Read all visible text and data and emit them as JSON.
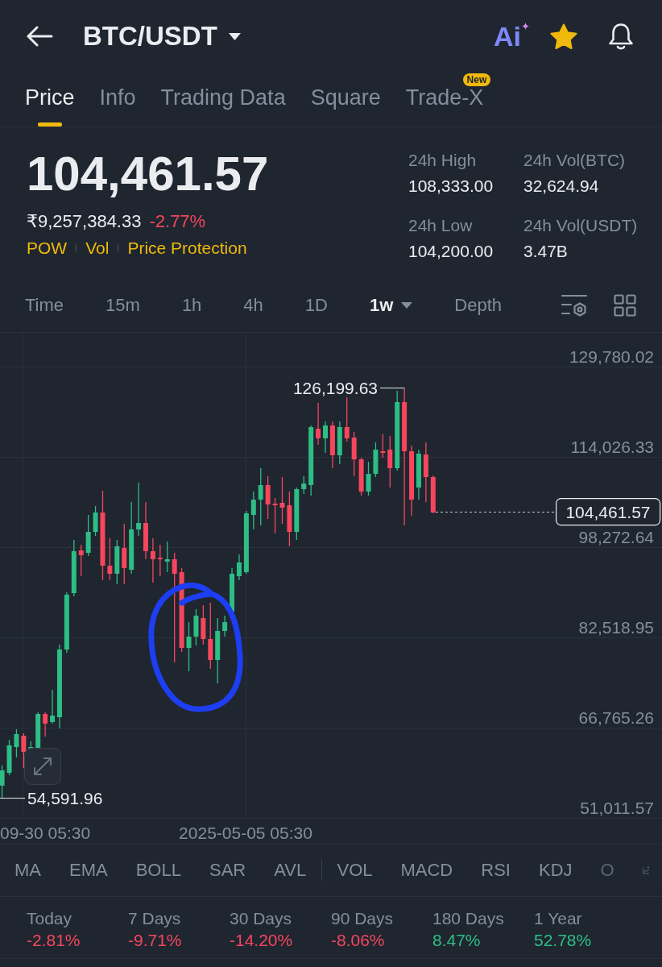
{
  "header": {
    "pair": "BTC/USDT",
    "ai_label": "Ai",
    "favorite": true
  },
  "tabs": [
    {
      "label": "Price",
      "selected": true
    },
    {
      "label": "Info",
      "selected": false
    },
    {
      "label": "Trading Data",
      "selected": false
    },
    {
      "label": "Square",
      "selected": false
    },
    {
      "label": "Trade-X",
      "selected": false,
      "badge": "New"
    }
  ],
  "price": {
    "last": "104,461.57",
    "fiat": "₹9,257,384.33",
    "change": "-2.77%",
    "tags": [
      "POW",
      "Vol",
      "Price Protection"
    ]
  },
  "stats": [
    {
      "label": "24h High",
      "value": "108,333.00"
    },
    {
      "label": "24h Vol(BTC)",
      "value": "32,624.94"
    },
    {
      "label": "24h Low",
      "value": "104,200.00"
    },
    {
      "label": "24h Vol(USDT)",
      "value": "3.47B"
    }
  ],
  "intervals": [
    {
      "label": "Time",
      "selected": false
    },
    {
      "label": "15m",
      "selected": false
    },
    {
      "label": "1h",
      "selected": false
    },
    {
      "label": "4h",
      "selected": false
    },
    {
      "label": "1D",
      "selected": false
    },
    {
      "label": "1w",
      "selected": true,
      "dropdown": true
    },
    {
      "label": "Depth",
      "selected": false
    }
  ],
  "chart": {
    "price_axis": [
      "129,780.02",
      "114,026.33",
      "98,272.64",
      "82,518.95",
      "66,765.26",
      "51,011.57"
    ],
    "time_axis": [
      "09-30 05:30",
      "2025-05-05 05:30"
    ],
    "high_label": "126,199.63",
    "low_label": "54,591.96",
    "current_price": "104,461.57"
  },
  "indicators": {
    "main": [
      "MA",
      "EMA",
      "BOLL",
      "SAR",
      "AVL"
    ],
    "sub": [
      "VOL",
      "MACD",
      "RSI",
      "KDJ",
      "O"
    ]
  },
  "performance": [
    {
      "period": "Today",
      "change": "-2.81%",
      "color": "#f6465d"
    },
    {
      "period": "7 Days",
      "change": "-9.71%",
      "color": "#f6465d"
    },
    {
      "period": "30 Days",
      "change": "-14.20%",
      "color": "#f6465d"
    },
    {
      "period": "90 Days",
      "change": "-8.06%",
      "color": "#f6465d"
    },
    {
      "period": "180 Days",
      "change": "8.47%",
      "color": "#2ebd85"
    },
    {
      "period": "1 Year",
      "change": "52.78%",
      "color": "#2ebd85"
    }
  ]
}
